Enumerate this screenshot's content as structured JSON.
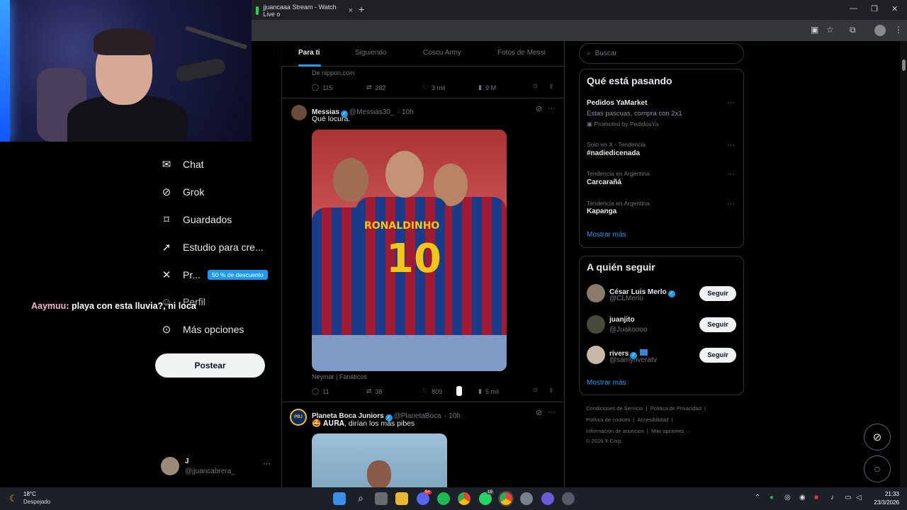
{
  "browser": {
    "tab_title": "jjuancaaa Stream - Watch Live o",
    "tab_close": "×",
    "new_tab": "+",
    "win_min": "—",
    "win_max": "❐",
    "win_close": "✕"
  },
  "chat_overlay": {
    "username": "Aaymuu",
    "message": ": playa con esta lluvia?, ni loca"
  },
  "sidebar": {
    "items": [
      {
        "label": "Chat",
        "icon": "envelope-icon",
        "glyph": "✉"
      },
      {
        "label": "Grok",
        "icon": "grok-icon",
        "glyph": "⊘"
      },
      {
        "label": "Guardados",
        "icon": "bookmark-icon",
        "glyph": "⌑"
      },
      {
        "label": "Estudio para cre...",
        "icon": "rocket-icon",
        "glyph": "➚"
      },
      {
        "label": "Pr...",
        "icon": "x-logo-icon",
        "glyph": "✕"
      },
      {
        "label": "Perfil",
        "icon": "person-icon",
        "glyph": "☺"
      },
      {
        "label": "Más opciones",
        "icon": "more-circle-icon",
        "glyph": "⊙"
      }
    ],
    "premium_badge": "50 % de descuento",
    "post_button": "Postear",
    "account_name": "J",
    "account_handle": "@jjuancabrera_",
    "account_more": "···"
  },
  "feed": {
    "tabs": [
      "Para ti",
      "Siguiendo",
      "Coscu Army",
      "Fotos de Messi"
    ],
    "prev_post": {
      "source": "De nippon.com",
      "replies": "115",
      "reposts": "282",
      "likes": "3 mil",
      "views": "9 M"
    },
    "post1": {
      "name": "Messias",
      "handle": "@Messias30_",
      "time": "· 10h",
      "text": "Qué locura.",
      "image_tag": "Neymar | Fanáticos",
      "jersey_name": "RONALDINHO",
      "jersey_number": "10",
      "replies": "11",
      "reposts": "38",
      "likes": "809",
      "views": "5 mil"
    },
    "post2": {
      "name": "Planeta Boca Juniors",
      "handle": "@PlanetaBoca",
      "time": "· 10h",
      "text_emoji": "🤩",
      "text_bold": "𝐀𝐔𝐑𝐀,",
      "text": " dirían los más pibes",
      "avatar_text": "PBJ"
    },
    "more_dots": "···"
  },
  "right": {
    "search_placeholder": "Buscar",
    "trends_title": "Qué está pasando",
    "promo": {
      "name": "Pedidos YaMarket",
      "desc": "Estas pascuas, compra con 2x1",
      "promoted": "Promoted by PedidosYa"
    },
    "trends": [
      {
        "meta": "Solo en X · Tendencia",
        "name": "#nadiedicenada"
      },
      {
        "meta": "Tendencia en Argentina",
        "name": "Carcarañá"
      },
      {
        "meta": "Tendencia en Argentina",
        "name": "Kapanga"
      }
    ],
    "trends_more": "Mostrar más",
    "follow_title": "A quién seguir",
    "follow": [
      {
        "name": "César Luis Merlo",
        "handle": "@CLMerlo",
        "button": "Seguir"
      },
      {
        "name": "juanjito",
        "handle": "@Juakoooo",
        "button": "Seguir"
      },
      {
        "name": "rivers",
        "handle": "@samyriveratv",
        "button": "Seguir"
      }
    ],
    "follow_more": "Mostrar más",
    "footer": {
      "l1a": "Condiciones de Servicio",
      "l1b": "Política de Privacidad",
      "l2a": "Política de cookies",
      "l2b": "Accesibilidad",
      "l3a": "Información de anuncios",
      "l3b": "Más opciones ···",
      "copy": "© 2026 X Corp."
    }
  },
  "taskbar": {
    "temp": "18°C",
    "condition": "Despejado",
    "time": "21:33",
    "date": "23/3/2026",
    "discord_badge": "9+",
    "whatsapp_badge": "19"
  },
  "colors": {
    "accent": "#1d9bf0",
    "bg": "#000000",
    "border": "#2f3336"
  }
}
